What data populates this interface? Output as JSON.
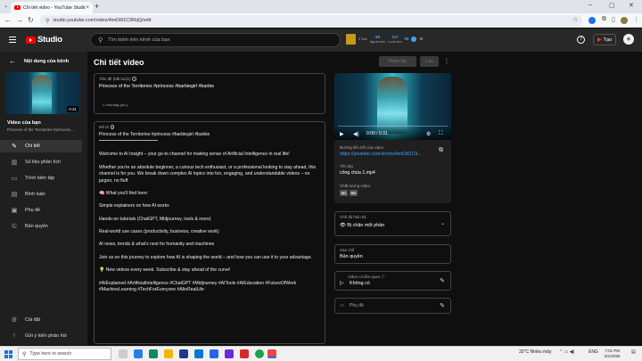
{
  "browser": {
    "tab_title": "Chi tiết video - YouTube Studio",
    "url": "studio.youtube.com/video/AmDi81C9RqQ/edit"
  },
  "header": {
    "logo_text": "Studio",
    "search_placeholder": "Tìm kiếm trên kênh của bạn",
    "stats": [
      {
        "value": "",
        "label": "0 Vide"
      },
      {
        "value": "80",
        "label": "Người xem"
      },
      {
        "value": "417",
        "label": "Lượt xem"
      },
      {
        "value": "95",
        "label": ""
      }
    ],
    "create_label": "Tạo"
  },
  "sidebar": {
    "back_label": "Nội dung của kênh",
    "thumb_duration": "0:31",
    "video_label": "Video của bạn",
    "video_title": "Princess of the Territories #princess...",
    "items": [
      {
        "label": "Chi tiết",
        "icon": "pencil-icon",
        "glyph": "✎"
      },
      {
        "label": "Số liệu phân tích",
        "icon": "analytics-icon",
        "glyph": "▥"
      },
      {
        "label": "Trình biên tập",
        "icon": "editor-icon",
        "glyph": "▭"
      },
      {
        "label": "Bình luận",
        "icon": "comments-icon",
        "glyph": "▤"
      },
      {
        "label": "Phụ đề",
        "icon": "subtitles-icon",
        "glyph": "▣"
      },
      {
        "label": "Bản quyền",
        "icon": "copyright-icon",
        "glyph": "©"
      }
    ],
    "bottom_items": [
      {
        "label": "Cài đặt",
        "icon": "gear-icon",
        "glyph": "⚙"
      },
      {
        "label": "Gửi ý kiến phản hồi",
        "icon": "feedback-icon",
        "glyph": "!"
      }
    ]
  },
  "main": {
    "page_title": "Chi tiết video",
    "undo_label": "Hoàn tác",
    "save_label": "Lưu",
    "title_field": {
      "label": "Tiêu đề (bắt buộc)",
      "value": "Princess of the Territories #princess #barbiegirl #barbie",
      "hashtag_hint": "Hashtag gợi ý"
    },
    "description_field": {
      "label": "Mô tả",
      "lines": [
        "Princess of the Territories #princess #barbiegirl #barbie",
        "",
        "Welcome to AI Insight – your go-to channel for making sense of Artificial Intelligence in real life!",
        "",
        "Whether you're an absolute beginner, a curious tech enthusiast, or a professional looking to stay ahead, this channel is for you. We break down complex AI topics into fun, engaging, and understandable videos – no jargon, no fluff.",
        "",
        "🧠 What you'll find here:",
        "",
        "Simple explainers on how AI works",
        "",
        "Hands-on tutorials (ChatGPT, Midjourney, tools & more)",
        "",
        "Real-world use cases (productivity, business, creative work)",
        "",
        "AI news, trends & what's next for humanity and machines",
        "",
        "Join us on this journey to explore how AI is shaping the world – and how you can use it to your advantage.",
        "",
        "💡 New videos every week. Subscribe & stay ahead of the curve!",
        "",
        "#AIExplained #ArtificialIntelligence #ChatGPT #Midjourney #AITools #AIEducation #FutureOfWork #MachineLearning #TechForEveryone #AIinRealLife"
      ]
    }
  },
  "right": {
    "player_time": "0:00 / 0:31",
    "link_label": "Đường liên kết của video",
    "link_value": "https://youtube.com/shorts/AmDi81C9...",
    "filename_label": "Tên tệp",
    "filename_value": "công chúa 1.mp4",
    "quality_label": "Chất lượng video",
    "quality_badges": [
      "SD",
      "HD"
    ],
    "visibility_label": "Chế độ hiển thị",
    "visibility_value": "Bị chặn một phần",
    "restrictions_label": "Hạn chế",
    "restrictions_value": "Bản quyền",
    "related_label": "Video có liên quan",
    "related_value": "Không có",
    "subtitles_label": "Phụ đề"
  },
  "taskbar": {
    "search_placeholder": "Type here to search",
    "weather": "32°C  Nhiều mây",
    "time": "7:01 PM",
    "date": "6/1/2025",
    "lang": "ENG"
  },
  "colors": {
    "background": "#0f0f0f",
    "surface": "#1f1f1f",
    "accent_link": "#3ea6ff",
    "brand_red": "#ff0000"
  }
}
